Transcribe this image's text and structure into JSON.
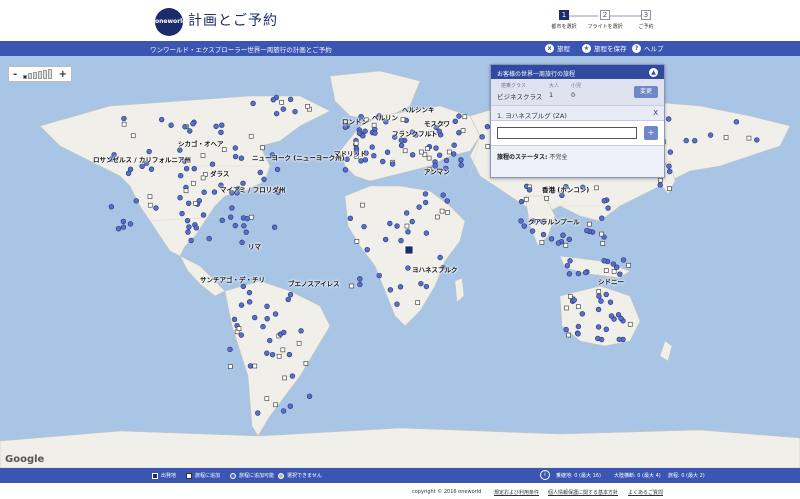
{
  "header": {
    "logo_text": "oneworld",
    "app_title": "計画とご予約",
    "steps": [
      {
        "num": "1",
        "label": "都市を選択"
      },
      {
        "num": "2",
        "label": "フライトを選択"
      },
      {
        "num": "3",
        "label": "ご予約"
      }
    ]
  },
  "bar": {
    "title": "ワンワールド・エクスプローラー世界一周旅行の計画とご予約",
    "links": [
      {
        "icon": "x",
        "label": "旅程"
      },
      {
        "icon": "★",
        "label": "旅程を保存"
      },
      {
        "icon": "?",
        "label": "ヘルプ"
      }
    ]
  },
  "map": {
    "zoom_in": "+",
    "zoom_out": "-",
    "attribution": "Google",
    "cities": [
      "シカゴ・オヘア",
      "ロサンゼルス / カリフォルニア州",
      "ニューヨーク (ニューヨーク州)",
      "ダラス",
      "マイアミ / フロリダ州",
      "リマ",
      "サンチアゴ・デ・チリ",
      "ブエノスアイレス",
      "ロンドン",
      "ヘルシンキ",
      "モスクワ",
      "ベルリン",
      "マドリッド",
      "フランクフルト",
      "アンマン",
      "香港 (ホンコン)",
      "クアラルンプール",
      "ヨハネスブルク",
      "シドニー"
    ]
  },
  "panel": {
    "header": "お客様の世界一周旅行の旅程",
    "collapse": "▲",
    "class_label": "搭乗クラス",
    "class_value": "ビジネスクラス",
    "adult_label": "大人",
    "adult_value": "1",
    "child_label": "小児",
    "child_value": "0",
    "change_label": "変更",
    "city_entry": "1. ヨハネスブルグ (ZA)",
    "city_remove": "X",
    "input_value": "",
    "add_label": "+",
    "status_label": "旅程のステータス:",
    "status_value": "不完全"
  },
  "legend": {
    "items": [
      {
        "label": "出発地",
        "color": "#1c2b6b"
      },
      {
        "label": "旅程に追加",
        "color": "#ffffff"
      },
      {
        "label": "旅程に追加可能",
        "color": "#5a6fc8"
      },
      {
        "label": "選択できません",
        "color": "#bbbbbb"
      }
    ],
    "stats": [
      "乗継地: 0 (最大 16)",
      "大陸横断: 0 (最大 4)",
      "旅程: 0 (最大 2)"
    ]
  },
  "footer": {
    "copyright": "copyright © 2016 oneworld",
    "links": [
      "規定および利用条件",
      "個人情報保護に関する基本方針",
      "よくあるご質問"
    ]
  }
}
